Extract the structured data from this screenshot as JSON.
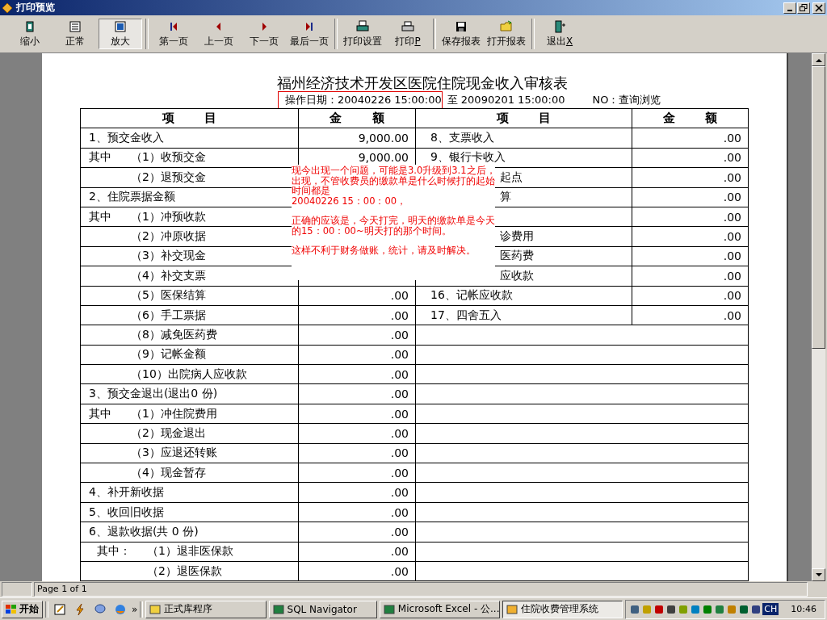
{
  "window": {
    "title": "打印预览"
  },
  "toolbar": [
    [
      {
        "label": "缩小",
        "selected": false
      },
      {
        "label": "正常",
        "selected": false
      },
      {
        "label": "放大",
        "selected": true
      }
    ],
    [
      {
        "label": "第一页",
        "selected": false
      },
      {
        "label": "上一页",
        "selected": false
      },
      {
        "label": "下一页",
        "selected": false
      },
      {
        "label": "最后一页",
        "selected": false
      }
    ],
    [
      {
        "label": "打印设置",
        "selected": false
      },
      {
        "label": "打印",
        "hotkey": "P",
        "selected": false
      }
    ],
    [
      {
        "label": "保存报表",
        "selected": false
      },
      {
        "label": "打开报表",
        "selected": false
      }
    ],
    [
      {
        "label": "退出",
        "hotkey": "X",
        "selected": false
      }
    ]
  ],
  "report": {
    "title": "福州经济技术开发区医院住院现金收入审核表",
    "date_line": {
      "highlighted": "操作日期：20040226 15:00:00",
      "rest": "至 20090201 15:00:00",
      "no": "NO：查询浏览"
    },
    "columns": [
      "项目",
      "金额",
      "项目",
      "金额"
    ],
    "left_items": [
      {
        "label": "1、预交金收入",
        "amount": "9,000.00",
        "children": [
          {
            "prefix": "其中",
            "label": "（1）收预交金",
            "amount": "9,000.00"
          },
          {
            "label": "（2）退预交金"
          }
        ]
      },
      {
        "label": "2、住院票据金额",
        "children": [
          {
            "prefix": "其中",
            "label": "（1）冲预收款"
          },
          {
            "label": "（2）冲原收据"
          },
          {
            "label": "（3）补交现金"
          },
          {
            "label": "（4）补交支票"
          },
          {
            "label": "（5）医保结算",
            "amount": ".00"
          },
          {
            "label": "（6）手工票据",
            "amount": ".00"
          },
          {
            "label": "（8）减免医药费",
            "amount": ".00"
          },
          {
            "label": "（9）记帐金额",
            "amount": ".00"
          },
          {
            "label": "（10）出院病人应收款",
            "amount": ".00"
          }
        ]
      },
      {
        "label": "3、预交金退出(退出0 份)",
        "amount": ".00",
        "children": [
          {
            "prefix": "其中",
            "label": "（1）冲住院费用",
            "amount": ".00"
          },
          {
            "label": "（2）现金退出",
            "amount": ".00"
          },
          {
            "label": "（3）应退还转账",
            "amount": ".00"
          },
          {
            "label": "（4）现金暂存",
            "amount": ".00"
          }
        ]
      },
      {
        "label": "4、补开新收据",
        "amount": ".00"
      },
      {
        "label": "5、收回旧收据",
        "amount": ".00"
      },
      {
        "label": "6、退款收据(共 0 份)",
        "amount": ".00",
        "children": [
          {
            "prefix": "其中：",
            "label": "（1）退非医保款",
            "amount": ".00"
          },
          {
            "label": "（2）退医保款",
            "amount": ".00"
          }
        ]
      }
    ],
    "right_rows": [
      {
        "label": "8、支票收入",
        "amount": ".00",
        "partial": false
      },
      {
        "label": "9、银行卡收入",
        "amount": ".00",
        "partial": false
      },
      {
        "label": "起点",
        "amount": ".00",
        "partial": true
      },
      {
        "label": "算",
        "amount": ".00",
        "partial": true
      },
      {
        "amount": ".00"
      },
      {
        "label": "诊费用",
        "amount": ".00",
        "partial": true
      },
      {
        "label": "医药费",
        "amount": ".00",
        "partial": true
      },
      {
        "label": "应收款",
        "amount": ".00",
        "partial": true
      },
      {
        "label": "16、记帐应收款",
        "amount": ".00",
        "partial": false
      },
      {
        "label": "17、四舍五入",
        "amount": ".00",
        "partial": false
      }
    ]
  },
  "note": {
    "paragraphs": [
      [
        "现今出现一个问题，可能是3.0升级到3.1之后，",
        "出现，不管收费员的缴款单是什么时候打的起始",
        "时间都是",
        "20040226 15：00：00，"
      ],
      [
        "正确的应该是，今天打完，明天的缴款单是今天",
        "的15：00：00~明天打的那个时间。"
      ],
      [
        "这样不利于财务做账，统计，请及时解决。"
      ]
    ]
  },
  "status_bar": {
    "page": "Page 1 of 1"
  },
  "taskbar": {
    "start": "开始",
    "more": "»",
    "tasks": [
      {
        "label": "正式库程序",
        "selected": false
      },
      {
        "label": "SQL Navigator",
        "selected": false
      },
      {
        "label": "Microsoft Excel - 公...",
        "selected": false
      },
      {
        "label": "住院收费管理系统",
        "selected": true
      }
    ],
    "language": "CH",
    "clock": "10:46"
  }
}
